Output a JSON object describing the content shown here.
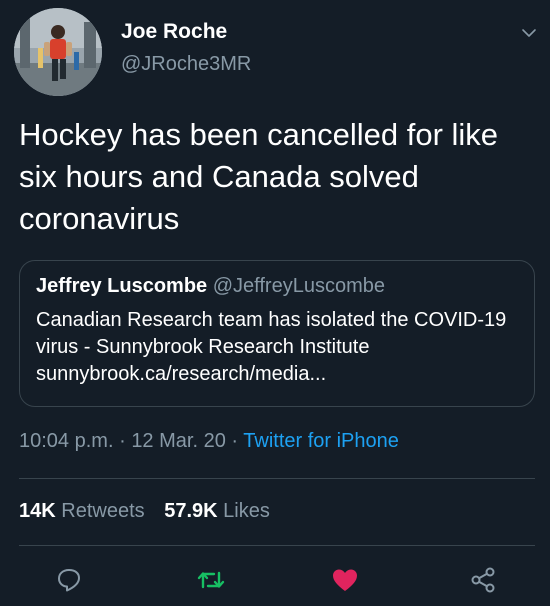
{
  "author": {
    "display_name": "Joe Roche",
    "handle": "@JRoche3MR"
  },
  "tweet_text": "Hockey has been cancelled for like six hours and Canada solved coronavirus",
  "quoted_tweet": {
    "author_name": "Jeffrey Luscombe",
    "author_handle": "@JeffreyLuscombe",
    "text": "Canadian Research team has isolated the COVID-19 virus - Sunnybrook Research Institute sunnybrook.ca/research/media..."
  },
  "meta": {
    "time": "10:04 p.m.",
    "separator": "·",
    "date": "12 Mar. 20",
    "source": "Twitter for iPhone"
  },
  "stats": {
    "retweets_count": "14K",
    "retweets_label": "Retweets",
    "likes_count": "57.9K",
    "likes_label": "Likes"
  },
  "icons": {
    "reply": "reply-icon",
    "retweet": "retweet-icon",
    "like": "heart-icon",
    "share": "share-icon",
    "caret": "chevron-down-icon"
  },
  "colors": {
    "background": "#141d27",
    "text_secondary": "#8899a6",
    "link": "#1da1f2",
    "retweet": "#17bf63",
    "like": "#e0245e",
    "border": "#38444d"
  }
}
